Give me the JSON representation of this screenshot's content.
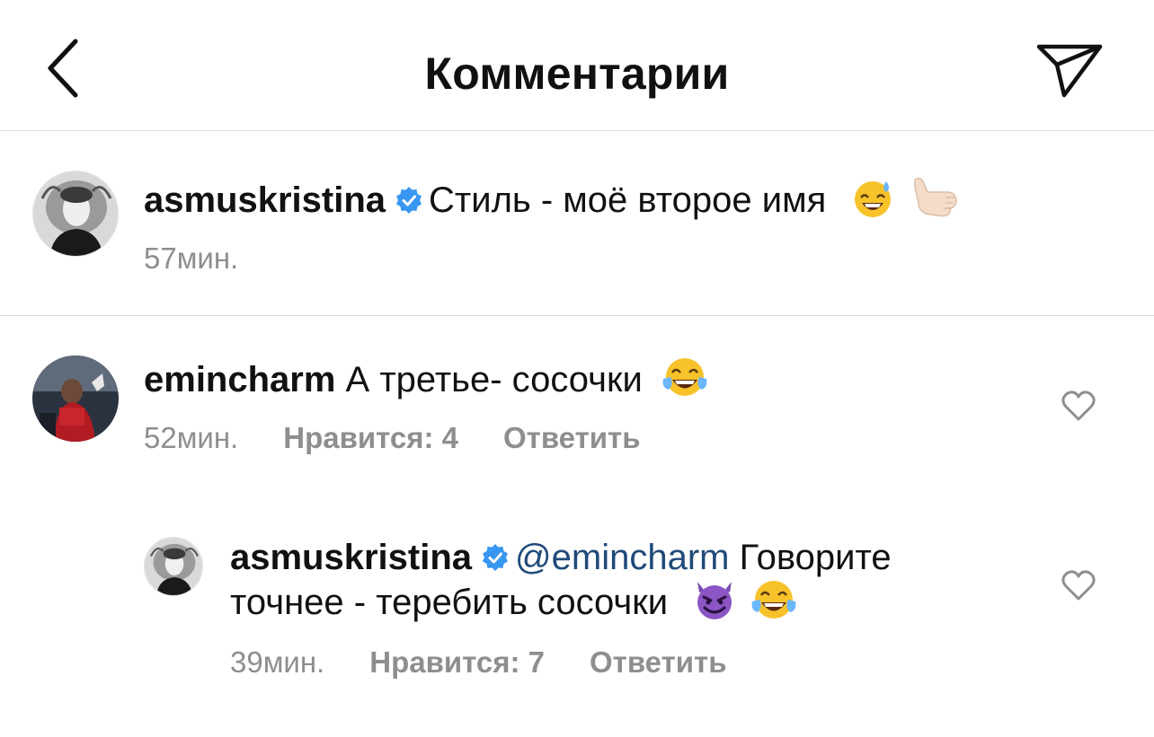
{
  "header": {
    "title": "Комментарии",
    "back_icon": "chevron-left-icon",
    "share_icon": "paper-plane-icon"
  },
  "caption": {
    "username": "asmuskristina",
    "verified": true,
    "text": "Стиль - моё второе имя",
    "emojis": [
      "sweat-smile-emoji",
      "call-me-hand-emoji"
    ],
    "time": "57мин."
  },
  "comments": [
    {
      "username": "emincharm",
      "text": "А третье- сосочки",
      "emojis": [
        "tears-of-joy-emoji"
      ],
      "time": "52мин.",
      "likes": "Нравится: 4",
      "reply": "Ответить"
    }
  ],
  "replies": [
    {
      "username": "asmuskristina",
      "verified": true,
      "mention": "@emincharm",
      "text_line1": "Говорите",
      "text_line2": "точнее - теребить сосочки",
      "emojis": [
        "smiling-devil-emoji",
        "tears-of-joy-emoji"
      ],
      "time": "39мин.",
      "likes": "Нравится: 7",
      "reply": "Ответить"
    }
  ],
  "colors": {
    "verified_blue": "#3897f0",
    "secondary_text": "#8e8e8e",
    "mention": "#1f4a7a",
    "divider": "#dbdbdb"
  }
}
